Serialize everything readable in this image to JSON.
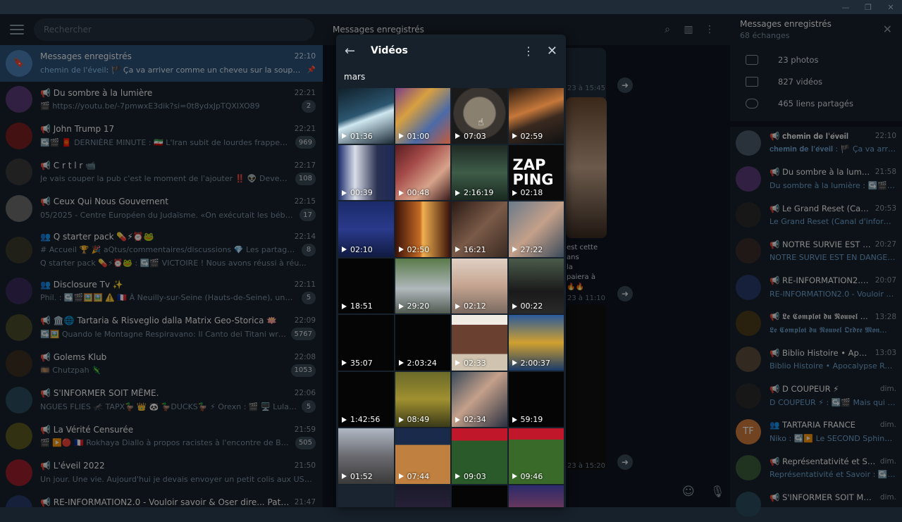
{
  "left": {
    "search_placeholder": "Rechercher",
    "chats": [
      {
        "name": "Messages enregistrés",
        "time": "22:10",
        "sender": "chemin de l'éveil",
        "msg": ": 🏴 Ça va arriver comme un cheveu sur la soupe ⚠️",
        "badge": "",
        "avatar": "🔖",
        "color": "#4a80b6",
        "active": true
      },
      {
        "name": "📢 Du sombre à la lumière",
        "time": "22:21",
        "sender": "",
        "msg": "🎬 https://youtu.be/-7pmwxE3dik?si=0t8ydxJpTQXIXO89",
        "badge": "2",
        "avatar": "",
        "color": "#5b3a78"
      },
      {
        "name": "📢 John Trump 17",
        "time": "22:21",
        "sender": "",
        "msg": "↪️🎬 🧧 DERNIÈRE MINUTE : 🇮🇷 L'Iran subit de lourdes frappes aérie...",
        "badge": "969",
        "avatar": "",
        "color": "#7a1f1f"
      },
      {
        "name": "📢 C  r t  l r     📹",
        "time": "22:17",
        "sender": "",
        "msg": "Je vais couper la pub c'est le moment de l'ajouter ‼️ 👽 Devenir me...",
        "badge": "108",
        "avatar": "",
        "color": "#3a3a3a"
      },
      {
        "name": "📢 Ceux Qui Nous Gouvernent",
        "time": "22:15",
        "sender": "",
        "msg": "05/2025 - Centre Européen du Judaïsme. «On exécutait les bébés, on att...",
        "badge": "17",
        "avatar": "",
        "color": "#6d6d6d"
      },
      {
        "name": "👥 Q starter pack 💊⚡⏰🐸",
        "time": "22:14",
        "sender": "",
        "msg": "# Accueil 🏆 🎉 aQtus/commentaires/discussions   💎 Les partages de...",
        "msg2": "Q starter pack 💊⚡⏰🐸 : ↪️🎬 VICTOIRE ! Nous avons réussi à réu...",
        "badge": "8",
        "avatar": "",
        "color": "#3b3b2b"
      },
      {
        "name": "👥 Disclosure Tv ✨",
        "time": "22:11",
        "sender": "",
        "msg": "Phil. : ↪️🎬🖼️🖼️ ⚠️ 🇫🇷 À Neuilly-sur-Seine (Hauts-de-Seine), une loge m...",
        "badge": "5",
        "avatar": "",
        "color": "#3a2a5a"
      },
      {
        "name": "📢 🏛️🌐 Tartaria & Risveglio dalla Matrix Geo-Storica 🪷",
        "time": "22:09",
        "sender": "",
        "msg": "↪️🖼️ Quando le Montagne Respiravano: Il Canto dei Titani written o...",
        "badge": "5767",
        "avatar": "",
        "color": "#4b4b2a"
      },
      {
        "name": "📢 Golems Klub",
        "time": "22:08",
        "sender": "",
        "msg": "🎞️ Chutzpah 🦎",
        "badge": "1053",
        "avatar": "",
        "color": "#3a3020"
      },
      {
        "name": "📢 S'INFORMER SOIT MÊME.",
        "time": "22:06",
        "sender": "",
        "msg": "NGUES FLIES 🦟 TAPX🦆 👑 🐼 🦆DUCKS🦆 ⚡ Orexn : 🎬 🖥️ Lula da ...",
        "badge": "5",
        "avatar": "",
        "color": "#2a4a5a"
      },
      {
        "name": "📢 La Vérité Censurée",
        "time": "21:59",
        "sender": "",
        "msg": "🎬 ▶️🔴 🇫🇷 Rokhaya Diallo à propos racistes à l'encontre de Bally Bag...",
        "badge": "505",
        "avatar": "",
        "color": "#5a5a20"
      },
      {
        "name": "📢 L'éveil 2022",
        "time": "21:50",
        "sender": "",
        "msg": "Un jour. Une vie.  Aujourd'hui je devais envoyer un petit colis aux USA en Ariz...",
        "badge": "",
        "avatar": "",
        "color": "#9a1f2a"
      },
      {
        "name": "📢 RE-INFORMATION2.0 - Vouloir savoir & Oser dire... Patience & Pers...",
        "time": "21:47",
        "sender": "",
        "msg": "",
        "badge": "",
        "avatar": "",
        "color": "#2a3a6a"
      }
    ]
  },
  "middle": {
    "title": "Messages enregistrés",
    "times": [
      "23 à 15:45",
      "23 à 11:10",
      "23 à 15:20"
    ],
    "fragment": [
      "est cette",
      "ans",
      "la",
      "paiera à",
      "🔥🔥"
    ]
  },
  "modal": {
    "title": "Vidéos",
    "month": "mars",
    "videos": [
      {
        "d": "01:36",
        "bg": "linear-gradient(160deg,#10202a 0%,#2c5670 45%,#cfe7f0 55%,#1b2a36 100%)"
      },
      {
        "d": "01:00",
        "bg": "linear-gradient(135deg,#7b3f86,#d8a040,#4a6aa8,#c45b3b)"
      },
      {
        "d": "07:03",
        "bg": "radial-gradient(circle at 50% 45%,#8a8070 0 22px,#3a3530 24px 36px,#1a1a1a 38px)"
      },
      {
        "d": "02:59",
        "bg": "linear-gradient(160deg,#2a1a10,#c6783a 40%,#3a2a20 60%,#111)"
      },
      {
        "d": "00:39",
        "bg": "linear-gradient(90deg,#1a2b6a,#d8dde8 30%,#2a3050 70%,#1f2a5a)"
      },
      {
        "d": "00:48",
        "bg": "linear-gradient(135deg,#5a1e22,#a44a48,#d7a38a,#3a1a1a)"
      },
      {
        "d": "2:16:19",
        "bg": "linear-gradient(180deg,#1f2a24,#3e5c48 50%,#1a2a20)"
      },
      {
        "d": "02:18",
        "bg": "#0a0a0a",
        "text": "ZAP\nPING"
      },
      {
        "d": "02:10",
        "bg": "linear-gradient(180deg,#1a2a6a,#2a3a8a 50%,#101a40)"
      },
      {
        "d": "02:50",
        "bg": "linear-gradient(90deg,#3a1208,#c46a24 45%,#f0b050 50%,#3a1208)"
      },
      {
        "d": "16:21",
        "bg": "linear-gradient(135deg,#2a1a14,#7a5a48,#3a2a22)"
      },
      {
        "d": "27:22",
        "bg": "linear-gradient(135deg,#6a7a8a,#c4a08a,#3a4a5a)"
      },
      {
        "d": "18:51",
        "bg": "#050505"
      },
      {
        "d": "29:20",
        "bg": "linear-gradient(180deg,#5a7a4a,#b0b8bc 55%,#505a50)"
      },
      {
        "d": "02:12",
        "bg": "linear-gradient(180deg,#e0d0c4,#c4a490,#7a6a60)"
      },
      {
        "d": "00:22",
        "bg": "linear-gradient(180deg,#4a5a4a,#1a1a1a 60%,#2a2a2a)"
      },
      {
        "d": "35:07",
        "bg": "#050505"
      },
      {
        "d": "2:03:24",
        "bg": "#050505"
      },
      {
        "d": "02:33",
        "bg": "linear-gradient(180deg,#f0ece4 0 18%,#6a4030 18% 70%,#d0c4b0 70%)"
      },
      {
        "d": "2:00:37",
        "bg": "linear-gradient(180deg,#2a5a9a,#d0a030 50%,#1a3a6a)"
      },
      {
        "d": "1:42:56",
        "bg": "#050505"
      },
      {
        "d": "08:49",
        "bg": "linear-gradient(180deg,#6a6a2a,#a09030 50%,#3a3a18)"
      },
      {
        "d": "02:34",
        "bg": "linear-gradient(135deg,#3a4a5a,#c4a08a 45%,#2a3040)"
      },
      {
        "d": "59:19",
        "bg": "#050505"
      },
      {
        "d": "01:52",
        "bg": "linear-gradient(180deg,#b0b8c4,#6a6a70 50%,#3a3a3a)"
      },
      {
        "d": "07:44",
        "bg": "linear-gradient(180deg,#1a2a4a 0 30%,#c08040 30% 100%)"
      },
      {
        "d": "09:03",
        "bg": "linear-gradient(180deg,#c0182a 0 22%,#2a5a2a 22% 100%)"
      },
      {
        "d": "09:46",
        "bg": "linear-gradient(180deg,#c0182a 0 20%,#3a6a2a 20% 100%)"
      },
      {
        "d": "",
        "bg": "#1a2430"
      },
      {
        "d": "",
        "bg": "linear-gradient(180deg,#1a1a2a,#3a2a4a)"
      },
      {
        "d": "",
        "bg": "#050505"
      },
      {
        "d": "",
        "bg": "linear-gradient(180deg,#2a2a6a,#c44a4a)"
      }
    ]
  },
  "right": {
    "title": "Messages enregistrés",
    "subtitle": "68 échanges",
    "stats": [
      "23 photos",
      "827 vidéos",
      "465 liens partagés"
    ],
    "chats": [
      {
        "name": "📢 𝐜𝐡𝐞𝐦𝐢𝐧 𝐝𝐞 𝐥'𝐞́𝐯𝐞𝐢𝐥",
        "time": "22:10",
        "msg": "𝐜𝐡𝐞𝐦𝐢𝐧 𝐝𝐞 𝐥'𝐞́𝐯𝐞𝐢𝐥 : 🏴 Ça va arriv...",
        "color": "#4a5a6a"
      },
      {
        "name": "📢 Du sombre à la lumière",
        "time": "21:58",
        "msg": "Du sombre à la lumière : ↪️🎬 Le pl...",
        "color": "#5b3a78"
      },
      {
        "name": "📢 Le Grand Reset (Canal d'...",
        "time": "20:53",
        "msg": "Le Grand Reset (Canal d'informati...",
        "color": "#2a2a2a"
      },
      {
        "name": "📢 NOTRE SURVIE EST EN D...",
        "time": "20:27",
        "msg": "NOTRE SURVIE EST EN DANGER, N...",
        "color": "#3a2a2a"
      },
      {
        "name": "📢 RE-INFORMATION2.0 - V...",
        "time": "20:07",
        "msg": "RE-INFORMATION2.0 - Vouloir sav...",
        "color": "#2a3a6a"
      },
      {
        "name": "📢 𝕷𝖊 𝕮𝖔𝖒𝖕𝖑𝖔𝖙 𝖉𝖚 𝕹𝖔𝖚𝖛𝖊𝖑 ...",
        "time": "13:28",
        "msg": "𝕷𝖊 𝕮𝖔𝖒𝖕𝖑𝖔𝖙 𝖉𝖚 𝕹𝖔𝖚𝖛𝖊𝖑 𝕺𝖗𝖉𝖗𝖊 𝕸𝖔𝖓...",
        "color": "#4a3a1a"
      },
      {
        "name": "📢 Biblio Histoire • Apocaly...",
        "time": "13:03",
        "msg": "Biblio Histoire • Apocalypse Révél...",
        "color": "#5a4a3a"
      },
      {
        "name": "📢 D COUPEUR ⚡",
        "time": "dim.",
        "msg": "D COUPEUR ⚡ : ↪️🎬 Mais qui s...",
        "color": "#2a2a2a"
      },
      {
        "name": "👥 TARTARIA FRANCE",
        "time": "dim.",
        "msg": "Niko : ↪️▶️ Le SECOND Sphinx de...",
        "color": "#d07a3a",
        "initials": "TF"
      },
      {
        "name": "📢 Représentativité et Savoir",
        "time": "dim.",
        "msg": "Représentativité et Savoir : ↪️▶️",
        "color": "#3a5a3a"
      },
      {
        "name": "📢 S'INFORMER SOIT MÊME.",
        "time": "dim.",
        "msg": "",
        "color": "#2a4a5a"
      }
    ]
  }
}
